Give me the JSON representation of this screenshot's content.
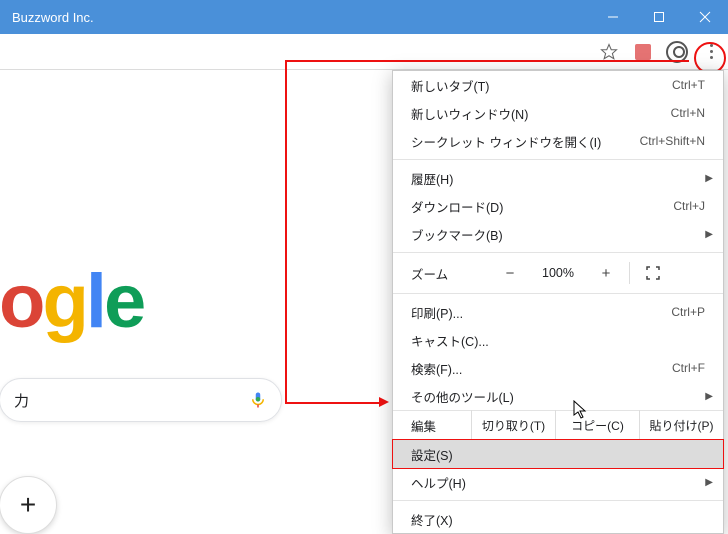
{
  "window": {
    "title": "Buzzword Inc."
  },
  "search": {
    "text": "力"
  },
  "menu": {
    "new_tab": "新しいタブ(T)",
    "new_tab_sc": "Ctrl+T",
    "new_window": "新しいウィンドウ(N)",
    "new_window_sc": "Ctrl+N",
    "incognito": "シークレット ウィンドウを開く(I)",
    "incognito_sc": "Ctrl+Shift+N",
    "history": "履歴(H)",
    "downloads": "ダウンロード(D)",
    "downloads_sc": "Ctrl+J",
    "bookmarks": "ブックマーク(B)",
    "zoom": "ズーム",
    "zoom_val": "100%",
    "print": "印刷(P)...",
    "print_sc": "Ctrl+P",
    "cast": "キャスト(C)...",
    "find": "検索(F)...",
    "find_sc": "Ctrl+F",
    "more_tools": "その他のツール(L)",
    "edit": "編集",
    "cut": "切り取り(T)",
    "copy": "コピー(C)",
    "paste": "貼り付け(P)",
    "settings": "設定(S)",
    "help": "ヘルプ(H)",
    "exit": "終了(X)"
  }
}
